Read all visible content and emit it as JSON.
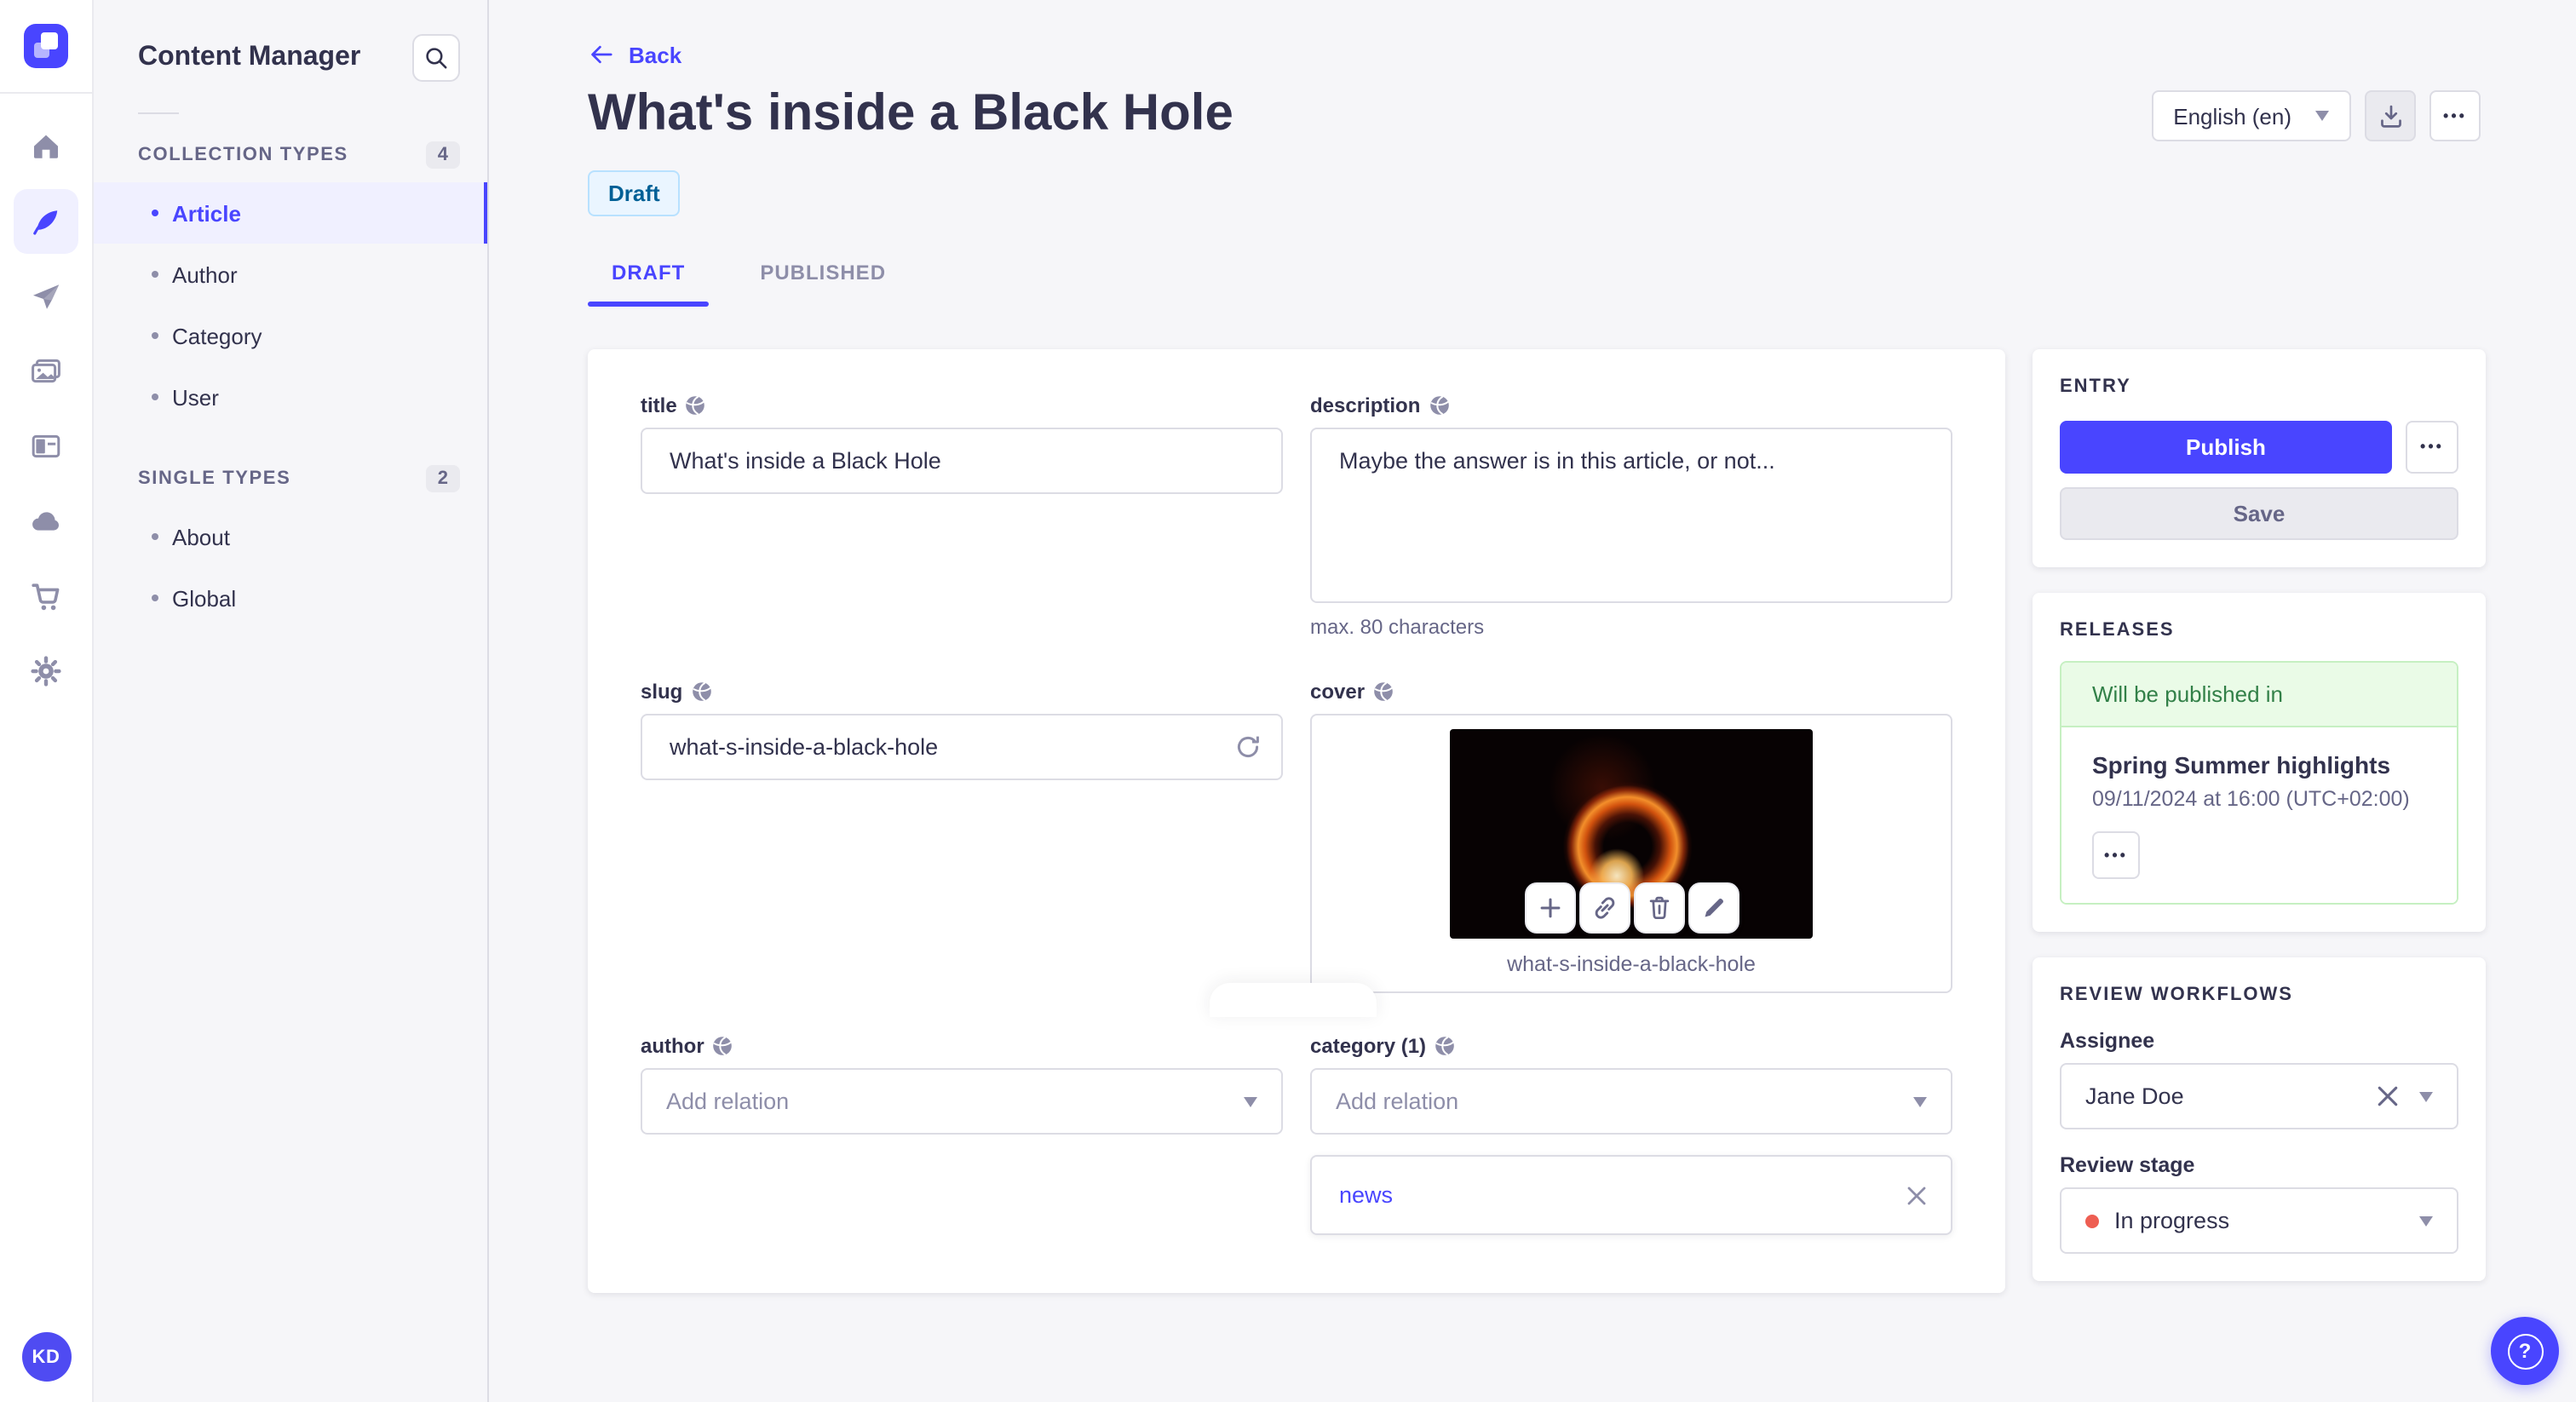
{
  "app": {
    "sidebar_title": "Content Manager"
  },
  "nav_rail": {
    "logo": "strapi-logo",
    "icons": [
      "home-icon",
      "feather-icon",
      "paper-plane-icon",
      "media-icon",
      "layout-icon",
      "cloud-icon",
      "cart-icon",
      "gear-icon"
    ],
    "active_icon": "feather-icon",
    "avatar_initials": "KD"
  },
  "sidebar": {
    "sections": [
      {
        "label": "COLLECTION TYPES",
        "count": "4",
        "items": [
          {
            "label": "Article",
            "active": true
          },
          {
            "label": "Author",
            "active": false
          },
          {
            "label": "Category",
            "active": false
          },
          {
            "label": "User",
            "active": false
          }
        ]
      },
      {
        "label": "SINGLE TYPES",
        "count": "2",
        "items": [
          {
            "label": "About",
            "active": false
          },
          {
            "label": "Global",
            "active": false
          }
        ]
      }
    ]
  },
  "header": {
    "back_label": "Back",
    "title": "What's inside a Black Hole",
    "status_badge": "Draft",
    "locale": "English (en)",
    "more_label": "•••"
  },
  "tabs": [
    {
      "label": "DRAFT",
      "active": true
    },
    {
      "label": "PUBLISHED",
      "active": false
    }
  ],
  "form": {
    "title": {
      "label": "title",
      "value": "What's inside a Black Hole"
    },
    "description": {
      "label": "description",
      "value": "Maybe the answer is in this article, or not...",
      "hint": "max. 80 characters"
    },
    "slug": {
      "label": "slug",
      "value": "what-s-inside-a-black-hole"
    },
    "cover": {
      "label": "cover",
      "caption": "what-s-inside-a-black-hole",
      "actions": [
        "add-media-icon",
        "copy-link-icon",
        "delete-icon",
        "edit-icon"
      ]
    },
    "author": {
      "label": "author",
      "placeholder": "Add relation"
    },
    "category": {
      "label": "category (1)",
      "placeholder": "Add relation",
      "relations": [
        {
          "label": "news"
        }
      ]
    }
  },
  "entry_panel": {
    "section_title": "ENTRY",
    "publish_label": "Publish",
    "save_label": "Save",
    "more_label": "•••"
  },
  "releases_panel": {
    "section_title": "RELEASES",
    "banner": "Will be published in",
    "release_name": "Spring Summer highlights",
    "release_date": "09/11/2024 at 16:00 (UTC+02:00)",
    "more_label": "•••"
  },
  "review_panel": {
    "section_title": "REVIEW WORKFLOWS",
    "assignee_label": "Assignee",
    "assignee_value": "Jane Doe",
    "stage_label": "Review stage",
    "stage_value": "In progress"
  },
  "colors": {
    "primary": "#4945ff",
    "primary_light": "#f0f0ff",
    "draft_text": "#006096",
    "draft_bg": "#eaf5ff",
    "success_text": "#328048",
    "success_bg": "#eafbe7",
    "success_border": "#c6f0c2",
    "danger_dot": "#ee5e52",
    "page_bg": "#f6f6f9"
  }
}
